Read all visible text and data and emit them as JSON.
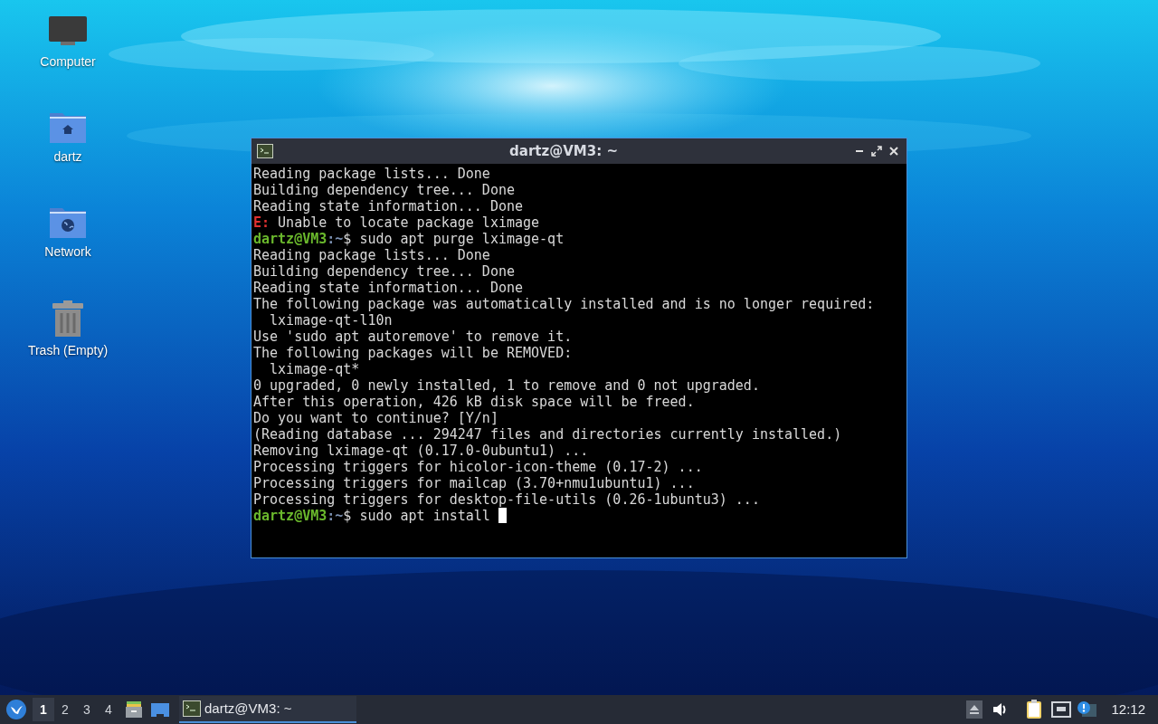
{
  "desktop_icons": [
    {
      "kind": "computer",
      "label": "Computer"
    },
    {
      "kind": "home",
      "label": "dartz"
    },
    {
      "kind": "network",
      "label": "Network"
    },
    {
      "kind": "trash",
      "label": "Trash (Empty)"
    }
  ],
  "terminal": {
    "title": "dartz@VM3: ~",
    "lines": [
      {
        "segments": [
          {
            "kind": "plain",
            "text": "Reading package lists... Done"
          }
        ]
      },
      {
        "segments": [
          {
            "kind": "plain",
            "text": "Building dependency tree... Done"
          }
        ]
      },
      {
        "segments": [
          {
            "kind": "plain",
            "text": "Reading state information... Done"
          }
        ]
      },
      {
        "segments": [
          {
            "kind": "error",
            "text": "E:"
          },
          {
            "kind": "plain",
            "text": " Unable to locate package lximage"
          }
        ]
      },
      {
        "segments": [
          {
            "kind": "user",
            "text": "dartz@VM3"
          },
          {
            "kind": "path",
            "text": ":~"
          },
          {
            "kind": "plain",
            "text": "$ sudo apt purge lximage-qt"
          }
        ]
      },
      {
        "segments": [
          {
            "kind": "plain",
            "text": "Reading package lists... Done"
          }
        ]
      },
      {
        "segments": [
          {
            "kind": "plain",
            "text": "Building dependency tree... Done"
          }
        ]
      },
      {
        "segments": [
          {
            "kind": "plain",
            "text": "Reading state information... Done"
          }
        ]
      },
      {
        "segments": [
          {
            "kind": "plain",
            "text": "The following package was automatically installed and is no longer required:"
          }
        ]
      },
      {
        "segments": [
          {
            "kind": "plain",
            "text": "  lximage-qt-l10n"
          }
        ]
      },
      {
        "segments": [
          {
            "kind": "plain",
            "text": "Use 'sudo apt autoremove' to remove it."
          }
        ]
      },
      {
        "segments": [
          {
            "kind": "plain",
            "text": "The following packages will be REMOVED:"
          }
        ]
      },
      {
        "segments": [
          {
            "kind": "plain",
            "text": "  lximage-qt*"
          }
        ]
      },
      {
        "segments": [
          {
            "kind": "plain",
            "text": "0 upgraded, 0 newly installed, 1 to remove and 0 not upgraded."
          }
        ]
      },
      {
        "segments": [
          {
            "kind": "plain",
            "text": "After this operation, 426 kB disk space will be freed."
          }
        ]
      },
      {
        "segments": [
          {
            "kind": "plain",
            "text": "Do you want to continue? [Y/n]"
          }
        ]
      },
      {
        "segments": [
          {
            "kind": "plain",
            "text": "(Reading database ... 294247 files and directories currently installed.)"
          }
        ]
      },
      {
        "segments": [
          {
            "kind": "plain",
            "text": "Removing lximage-qt (0.17.0-0ubuntu1) ..."
          }
        ]
      },
      {
        "segments": [
          {
            "kind": "plain",
            "text": "Processing triggers for hicolor-icon-theme (0.17-2) ..."
          }
        ]
      },
      {
        "segments": [
          {
            "kind": "plain",
            "text": "Processing triggers for mailcap (3.70+nmu1ubuntu1) ..."
          }
        ]
      },
      {
        "segments": [
          {
            "kind": "plain",
            "text": "Processing triggers for desktop-file-utils (0.26-1ubuntu3) ..."
          }
        ]
      },
      {
        "segments": [
          {
            "kind": "user",
            "text": "dartz@VM3"
          },
          {
            "kind": "path",
            "text": ":~"
          },
          {
            "kind": "plain",
            "text": "$ sudo apt install "
          }
        ],
        "cursor": true
      }
    ]
  },
  "taskbar": {
    "workspaces": [
      {
        "label": "1",
        "selected": true
      },
      {
        "label": "2",
        "selected": false
      },
      {
        "label": "3",
        "selected": false
      },
      {
        "label": "4",
        "selected": false
      }
    ],
    "tasks": [
      {
        "label": "dartz@VM3: ~",
        "selected": true
      }
    ],
    "clock": "12:12"
  }
}
